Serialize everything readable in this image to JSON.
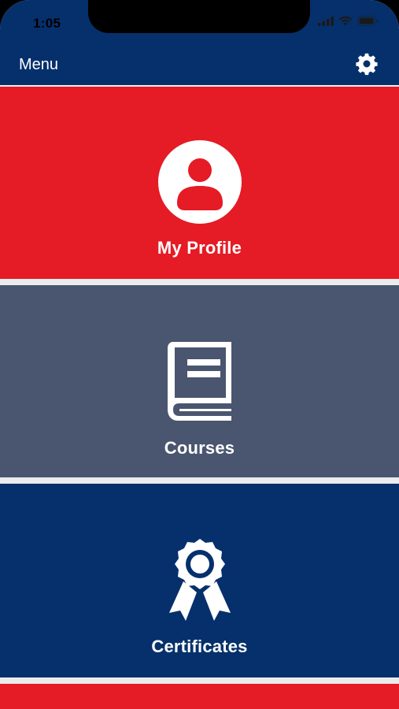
{
  "status_bar": {
    "time": "1:05"
  },
  "nav": {
    "title": "Menu",
    "settings_icon": "gear-icon"
  },
  "tiles": [
    {
      "label": "My Profile",
      "icon": "user-avatar-icon",
      "color": "#e51b25"
    },
    {
      "label": "Courses",
      "icon": "book-icon",
      "color": "#4a566f"
    },
    {
      "label": "Certificates",
      "icon": "award-ribbon-icon",
      "color": "#06306b"
    }
  ],
  "colors": {
    "header": "#06306b",
    "separator": "#ececec"
  }
}
